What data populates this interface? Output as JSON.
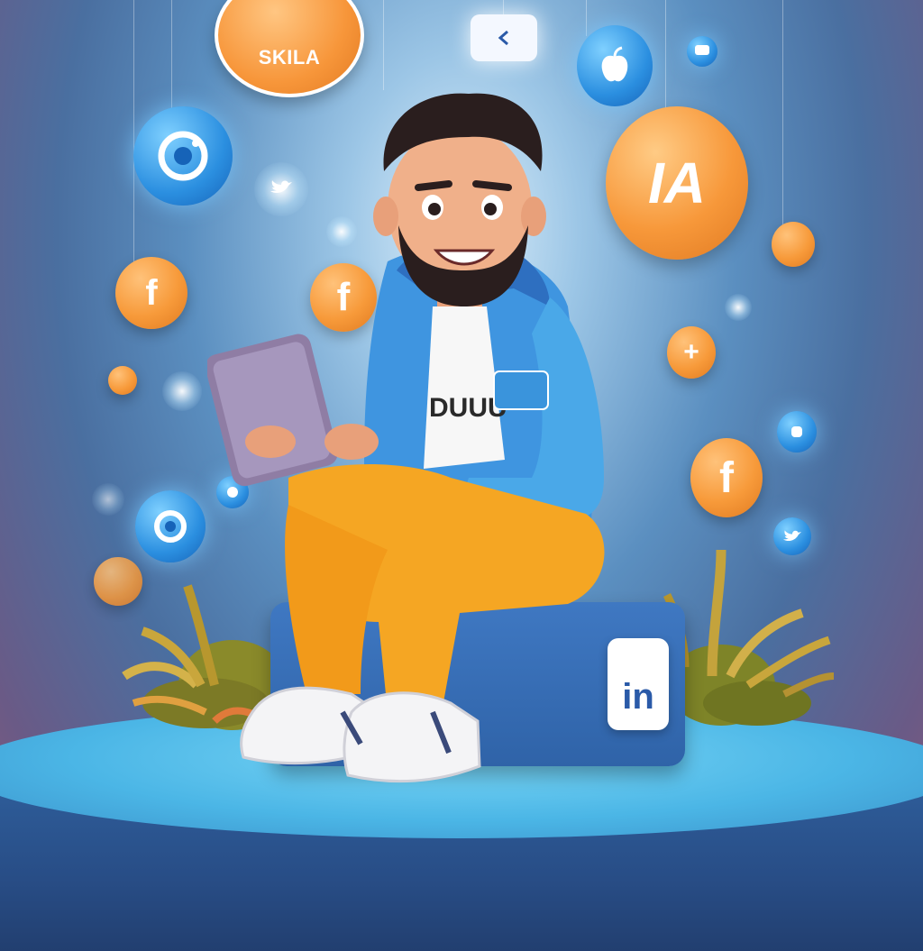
{
  "scene": {
    "brand_bubble_text": "SKILA",
    "ia_bubble_text": "IA",
    "letter_f_1": "f",
    "letter_f_2": "f",
    "letter_f_3": "f",
    "plus_sign": "+",
    "box_logo_text": "in",
    "shirt_text": "DUUU"
  },
  "colors": {
    "orange": "#f7983a",
    "blue": "#2b8fe0",
    "hoodie": "#4aa8e8",
    "pants": "#f5a623",
    "platform": "#4bb6e6"
  },
  "icons": [
    "camera-icon",
    "twitter-bird-icon",
    "apple-icon",
    "facebook-icon",
    "linkedin-icon",
    "chat-bubble-icon",
    "at-sign-icon"
  ]
}
